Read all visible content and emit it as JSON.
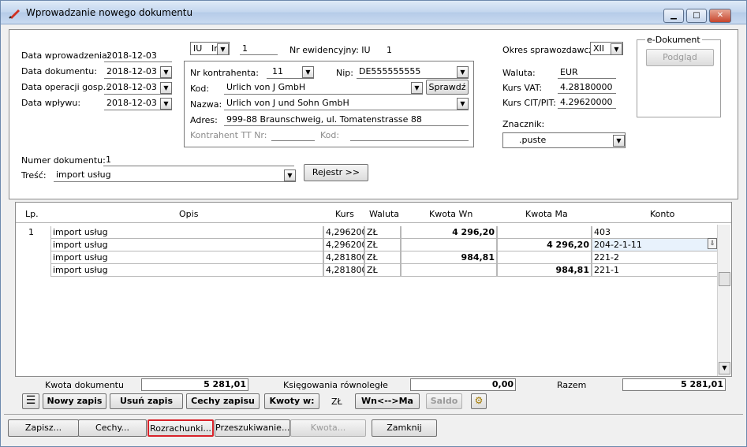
{
  "window": {
    "title": "Wprowadzanie nowego dokumentu"
  },
  "left": {
    "data_wprowadzenia_label": "Data wprowadzenia:",
    "data_wprowadzenia": "2018-12-03",
    "data_dokumentu_label": "Data dokumentu:",
    "data_dokumentu": "2018-12-03",
    "data_operacji_label": "Data operacji gosp.:",
    "data_operacji": "2018-12-03",
    "data_wplywu_label": "Data wpływu:",
    "data_wplywu": "2018-12-03",
    "numer_label": "Numer dokumentu:",
    "numer": "1",
    "tresc_label": "Treść:",
    "tresc": "import usług",
    "rejestr_button": "Rejestr >>"
  },
  "mid": {
    "typ1": "IU",
    "typ2": "Ir",
    "nr": "1",
    "nr_ewid_label": "Nr ewidencyjny: IU",
    "nr_ewid": "1",
    "nr_kontrahenta_label": "Nr kontrahenta:",
    "nr_kontrahenta": "11",
    "nip_label": "Nip:",
    "nip": "DE555555555",
    "kod_label": "Kod:",
    "kod": "Urlich von J GmbH",
    "sprawdz_button": "Sprawdź",
    "nazwa_label": "Nazwa:",
    "nazwa": "Urlich von J und Sohn GmbH",
    "adres_label": "Adres:",
    "adres": "999-88 Braunschweig, ul. Tomatenstrasse 88",
    "kontrahent_tt_label": "Kontrahent TT Nr:",
    "kod2_label": "Kod:"
  },
  "right": {
    "okres_label": "Okres sprawozdawczy:",
    "okres": "XII",
    "waluta_label": "Waluta:",
    "waluta": "EUR",
    "kurs_vat_label": "Kurs VAT:",
    "kurs_vat": "4.28180000",
    "kurs_cit_label": "Kurs CIT/PIT:",
    "kurs_cit": "4.29620000",
    "znacznik_label": "Znacznik:",
    "znacznik": ".puste",
    "edok_label": "e-Dokument",
    "podglad_button": "Podgląd"
  },
  "grid": {
    "headers": [
      "Lp.",
      "Opis",
      "Kurs",
      "Waluta",
      "Kwota Wn",
      "Kwota Ma",
      "Konto"
    ],
    "rows": [
      {
        "lp": "1",
        "opis": "import usług",
        "kurs": "4,296200",
        "waluta": "ZŁ",
        "wn": "4 296,20",
        "ma": "",
        "konto": "403"
      },
      {
        "lp": "",
        "opis": "import usług",
        "kurs": "4,296200",
        "waluta": "ZŁ",
        "wn": "",
        "ma": "4 296,20",
        "konto": "204-2-1-11"
      },
      {
        "lp": "",
        "opis": "import usług",
        "kurs": "4,281800",
        "waluta": "ZŁ",
        "wn": "984,81",
        "ma": "",
        "konto": "221-2"
      },
      {
        "lp": "",
        "opis": "import usług",
        "kurs": "4,281800",
        "waluta": "ZŁ",
        "wn": "",
        "ma": "984,81",
        "konto": "221-1"
      }
    ]
  },
  "totals": {
    "kwota_label": "Kwota dokumentu",
    "kwota": "5 281,01",
    "ksieg_label": "Księgowania równoległe",
    "ksieg": "0,00",
    "razem_label": "Razem",
    "razem": "5 281,01"
  },
  "actions": {
    "nowy": "Nowy zapis",
    "usun": "Usuń zapis",
    "cechy_zapisu": "Cechy zapisu",
    "kwoty": "Kwoty w:",
    "waluta": "ZŁ",
    "wnma": "Wn<-->Ma",
    "saldo": "Saldo"
  },
  "bottom": {
    "zapisz": "Zapisz...",
    "cechy": "Cechy...",
    "rozrachunki": "Rozrachunki...",
    "przeszukiwanie": "Przeszukiwanie...",
    "kwota": "Kwota...",
    "zamknij": "Zamknij"
  }
}
